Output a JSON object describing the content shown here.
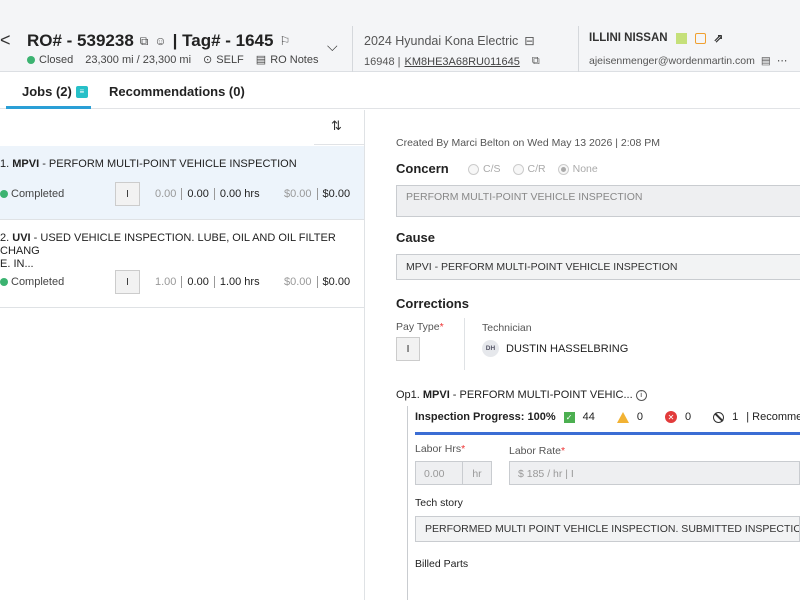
{
  "header": {
    "back_glyph": "<",
    "ro_label": "RO# - 539238",
    "tag_label": "| Tag# - 1645",
    "status": "Closed",
    "mileage": "23,300 mi / 23,300 mi",
    "self_label": "SELF",
    "ro_notes_label": "RO Notes",
    "vehicle": "2024 Hyundai Kona Electric",
    "stock": "16948 |",
    "vin": "KM8HE3A68RU011645",
    "dealer": "ILLINI NISSAN",
    "email": "ajeisenmenger@wordenmartin.com",
    "status_color": "#3cb371"
  },
  "tabs": {
    "jobs": "Jobs (2)",
    "recommendations": "Recommendations (0)"
  },
  "jobs": [
    {
      "code": "MPVI",
      "num": "1.",
      "desc": " - PERFORM MULTI-POINT VEHICLE INSPECTION",
      "status": "Completed",
      "pay": "I",
      "v1": "0.00",
      "v2": "0.00",
      "v3": "0.00 hrs",
      "amt1": "$0.00",
      "amt2": "$0.00"
    },
    {
      "code": "UVI",
      "num": "2.",
      "desc": " - USED VEHICLE INSPECTION. LUBE, OIL AND OIL FILTER CHANG",
      "desc2": "E. IN...",
      "status": "Completed",
      "pay": "I",
      "v1": "1.00",
      "v2": "0.00",
      "v3": "1.00 hrs",
      "amt1": "$0.00",
      "amt2": "$0.00"
    }
  ],
  "detail": {
    "created": "Created By Marci Belton on Wed May 13 2026 | 2:08 PM",
    "concern_label": "Concern",
    "radio_cs": "C/S",
    "radio_cr": "C/R",
    "radio_none": "None",
    "concern_text": "PERFORM MULTI-POINT VEHICLE INSPECTION",
    "cause_label": "Cause",
    "cause_text": "MPVI - PERFORM MULTI-POINT VEHICLE INSPECTION",
    "corrections_label": "Corrections",
    "pay_type_label": "Pay Type",
    "pay_type_value": "I",
    "technician_label": "Technician",
    "tech_initials": "DH",
    "tech_name": "DUSTIN HASSELBRING",
    "op_prefix": "Op1.",
    "op_code": "MPVI",
    "op_desc": " - PERFORM MULTI-POINT VEHIC...",
    "inspection_progress": "Inspection Progress: 100%",
    "green_count": "44",
    "yellow_count": "0",
    "red_count": "0",
    "na_count": "1",
    "recommend_label": "| Recomme",
    "labor_hrs_label": "Labor Hrs",
    "labor_hrs_value": "0.00",
    "labor_hrs_unit": "hr",
    "labor_rate_label": "Labor Rate",
    "labor_rate_value": "$ 185 / hr | I",
    "tech_story_label": "Tech story",
    "tech_story_text": "PERFORMED MULTI POINT VEHICLE INSPECTION. SUBMITTED INSPECTION",
    "billed_parts_label": "Billed Parts"
  }
}
